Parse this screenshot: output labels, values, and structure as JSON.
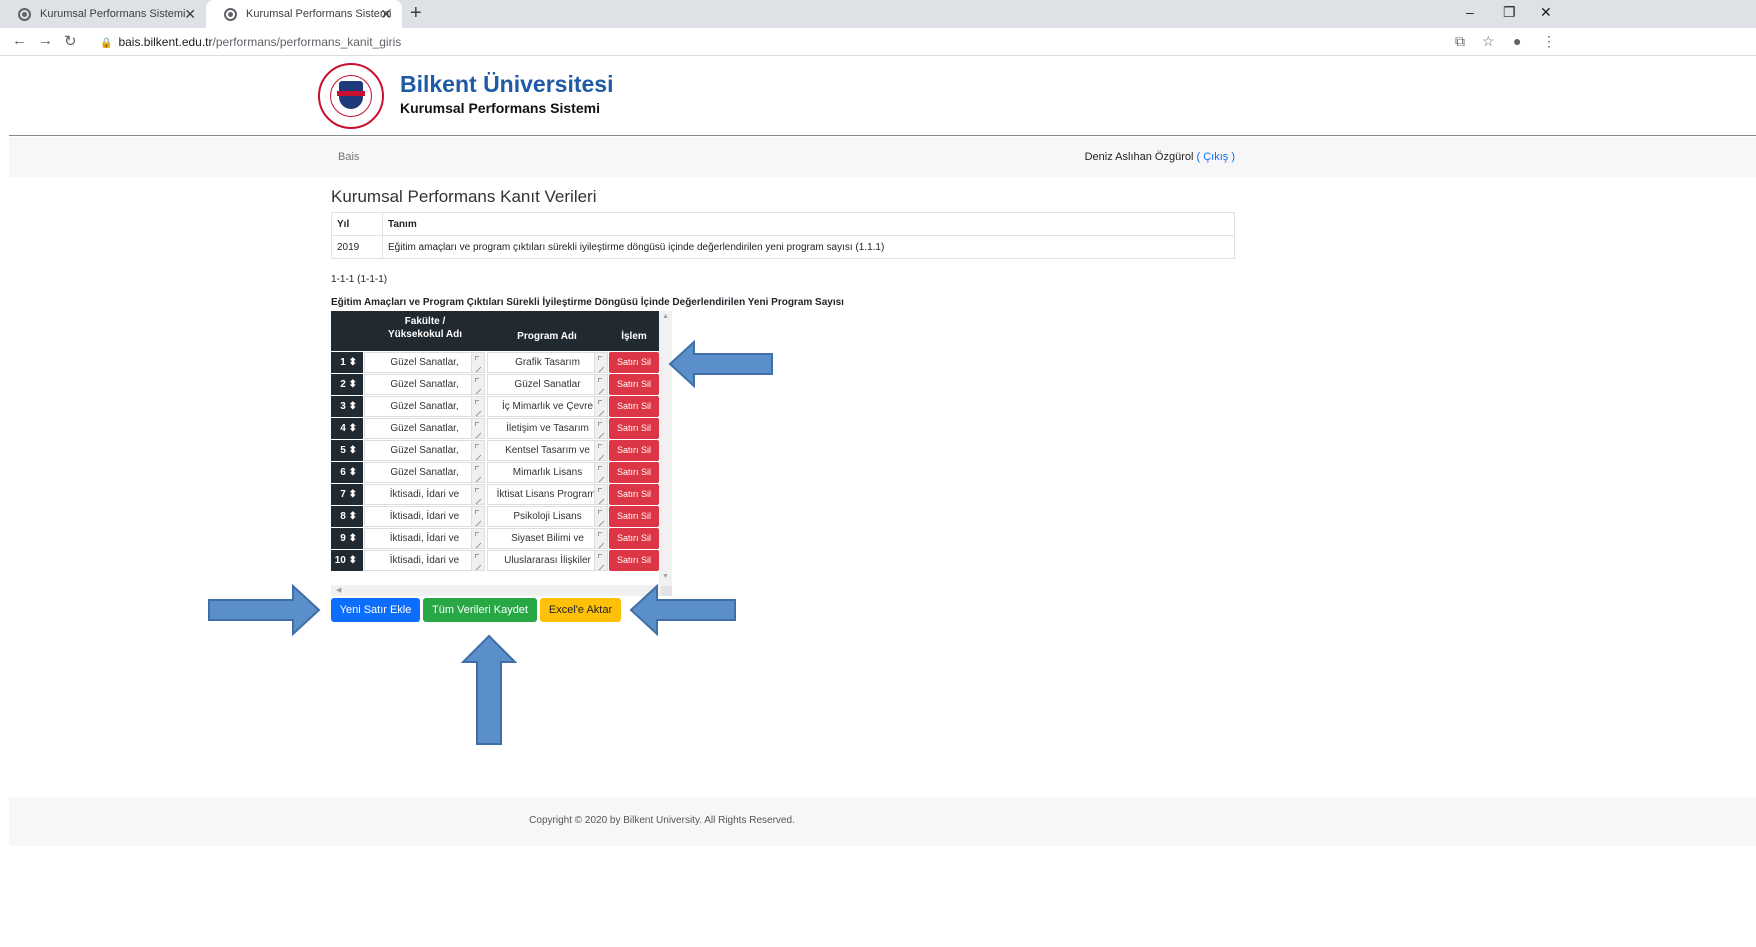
{
  "browser": {
    "tabs": [
      {
        "title": "Kurumsal Performans Sistemi"
      },
      {
        "title": "Kurumsal Performans Sistemi"
      }
    ],
    "url_host": "bais.bilkent.edu.tr",
    "url_path": "/performans/performans_kanit_giris"
  },
  "header": {
    "title": "Bilkent Üniversitesi",
    "subtitle": "Kurumsal Performans Sistemi"
  },
  "nav": {
    "breadcrumb": "Bais",
    "user_name": "Deniz Aslıhan Özgürol",
    "logout": "( Çıkış )"
  },
  "page": {
    "title": "Kurumsal Performans Kanıt Verileri",
    "info_headers": [
      "Yıl",
      "Tanım"
    ],
    "info_row": [
      "2019",
      "Eğitim amaçları ve program çıktıları sürekli iyileştirme döngüsü içinde değerlendirilen yeni program sayısı (1.1.1)"
    ],
    "code": "1-1-1 (1-1-1)",
    "subtitle": "Eğitim Amaçları ve Program Çıktıları Sürekli İyileştirme Döngüsü İçinde Değerlendirilen Yeni Program Sayısı"
  },
  "grid": {
    "headers": [
      "Fakülte /",
      "Yüksekokul Adı",
      "Program Adı",
      "İşlem"
    ],
    "sort_glyph": "⬍",
    "rows": [
      {
        "num": "1",
        "faculty": "Güzel Sanatlar,",
        "program": "Grafik Tasarım",
        "action": "Satırı Sil"
      },
      {
        "num": "2",
        "faculty": "Güzel Sanatlar,",
        "program": "Güzel Sanatlar",
        "action": "Satırı Sil"
      },
      {
        "num": "3",
        "faculty": "Güzel Sanatlar,",
        "program": "İç Mimarlık ve Çevre",
        "action": "Satırı Sil"
      },
      {
        "num": "4",
        "faculty": "Güzel Sanatlar,",
        "program": "İletişim ve Tasarım",
        "action": "Satırı Sil"
      },
      {
        "num": "5",
        "faculty": "Güzel Sanatlar,",
        "program": "Kentsel Tasarım ve",
        "action": "Satırı Sil"
      },
      {
        "num": "6",
        "faculty": "Güzel Sanatlar,",
        "program": "Mimarlık Lisans",
        "action": "Satırı Sil"
      },
      {
        "num": "7",
        "faculty": "İktisadi, İdari ve",
        "program": "İktisat Lisans Programı",
        "action": "Satırı Sil"
      },
      {
        "num": "8",
        "faculty": "İktisadi, İdari ve",
        "program": "Psikoloji Lisans",
        "action": "Satırı Sil"
      },
      {
        "num": "9",
        "faculty": "İktisadi, İdari ve",
        "program": "Siyaset Bilimi ve",
        "action": "Satırı Sil"
      },
      {
        "num": "10",
        "faculty": "İktisadi, İdari ve",
        "program": "Uluslararası İlişkiler",
        "action": "Satırı Sil"
      }
    ]
  },
  "actions": {
    "add_row": "Yeni Satır Ekle",
    "save_all": "Tüm Verileri Kaydet",
    "export_excel": "Excel'e Aktar"
  },
  "footer": {
    "copyright": "Copyright © 2020 by Bilkent University. All Rights Reserved."
  },
  "colors": {
    "brand": "#1f5aa6",
    "delete": "#dc3545",
    "primary": "#0d6efd",
    "success": "#28a745",
    "warning": "#ffc107",
    "annotation_arrow": "#5b8fc9"
  }
}
